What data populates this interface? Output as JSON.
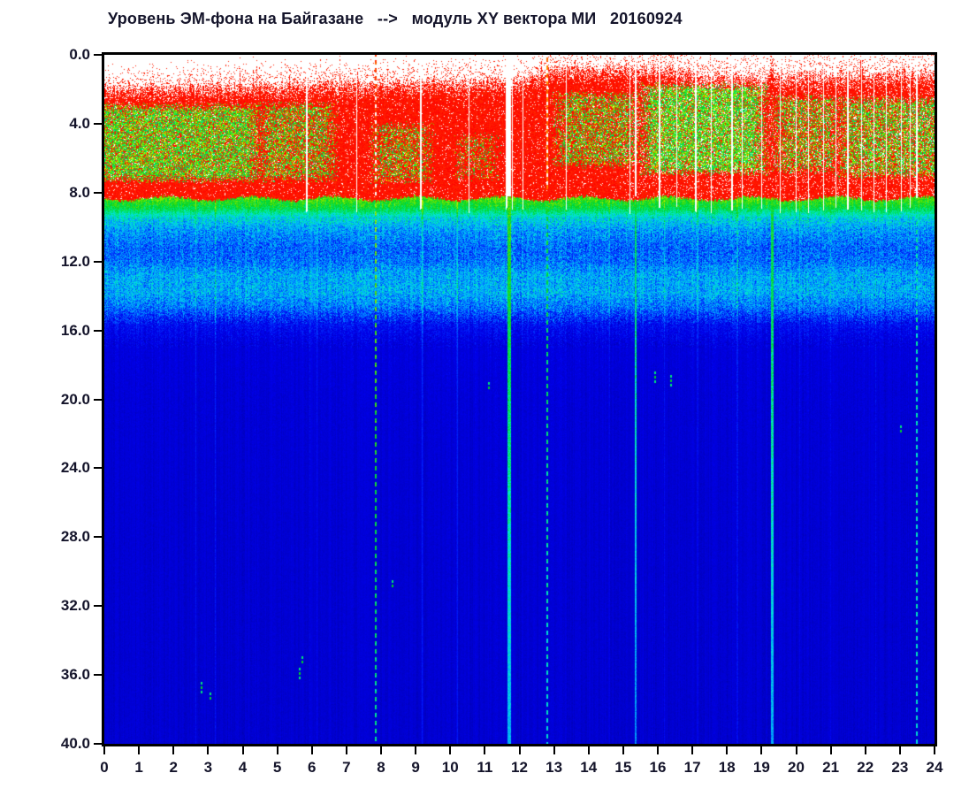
{
  "page": {
    "background": "#ffffff",
    "axis_color": "#000000",
    "text_color": "#14142a"
  },
  "chart_data": {
    "type": "heatmap",
    "title": "Уровень ЭМ-фона на Байгазане   -->   модуль XY вектора МИ   20160924",
    "x_axis": {
      "min": 0,
      "max": 24,
      "tick_labels": [
        "0",
        "1",
        "2",
        "3",
        "4",
        "5",
        "6",
        "7",
        "8",
        "9",
        "10",
        "11",
        "12",
        "13",
        "14",
        "15",
        "16",
        "17",
        "18",
        "19",
        "20",
        "21",
        "22",
        "23",
        "24"
      ]
    },
    "y_axis": {
      "min": 0,
      "max": 40,
      "inverted": true,
      "tick_labels": [
        "0.0",
        "4.0",
        "8.0",
        "12.0",
        "16.0",
        "20.0",
        "24.0",
        "28.0",
        "32.0",
        "36.0",
        "40.0"
      ]
    },
    "no_data_color": "#ffffff",
    "render": {
      "colormap_stops": [
        [
          0.0,
          0,
          0,
          150
        ],
        [
          0.08,
          0,
          0,
          200
        ],
        [
          0.16,
          0,
          0,
          235
        ],
        [
          0.24,
          0,
          60,
          255
        ],
        [
          0.32,
          0,
          160,
          255
        ],
        [
          0.4,
          0,
          225,
          225
        ],
        [
          0.46,
          0,
          230,
          120
        ],
        [
          0.52,
          0,
          210,
          40
        ],
        [
          0.58,
          110,
          230,
          0
        ],
        [
          0.65,
          220,
          240,
          0
        ],
        [
          0.72,
          255,
          220,
          0
        ],
        [
          0.8,
          255,
          120,
          0
        ],
        [
          0.86,
          255,
          40,
          0
        ],
        [
          1.0,
          255,
          0,
          0
        ]
      ],
      "band_profile": [
        [
          8.35,
          0.56
        ],
        [
          8.9,
          0.5
        ],
        [
          9.4,
          0.4
        ],
        [
          10.2,
          0.32
        ],
        [
          11.2,
          0.27
        ],
        [
          12.0,
          0.28
        ],
        [
          12.7,
          0.33
        ],
        [
          13.8,
          0.34
        ],
        [
          14.7,
          0.28
        ],
        [
          15.6,
          0.18
        ],
        [
          16.8,
          0.13
        ],
        [
          20,
          0.115
        ],
        [
          28,
          0.105
        ],
        [
          40,
          0.1
        ]
      ],
      "noise_amp": [
        [
          9.4,
          0.1
        ],
        [
          15.6,
          0.17
        ],
        [
          17,
          0.1
        ],
        [
          22,
          0.055
        ],
        [
          41,
          0.045
        ]
      ],
      "top_edge": [
        [
          0,
          1.9
        ],
        [
          5,
          1.75
        ],
        [
          8,
          1.6
        ],
        [
          11,
          1.5
        ],
        [
          12.3,
          1.3
        ],
        [
          13,
          0.8
        ],
        [
          16.3,
          0.75
        ],
        [
          17.2,
          1.15
        ],
        [
          19,
          1.25
        ],
        [
          19.6,
          1.2
        ],
        [
          21.7,
          1.1
        ],
        [
          22.1,
          1.15
        ],
        [
          23,
          1.05
        ],
        [
          24,
          1.0
        ]
      ],
      "top_spikes": [
        {
          "t": 13.6,
          "w": 0.06
        },
        {
          "t": 16.1,
          "w": 0.06
        },
        {
          "t": 19.3,
          "w": 0.1
        },
        {
          "t": 21.9,
          "w": 0.08
        }
      ],
      "hot": {
        "base": 0.86,
        "spread": 0.14,
        "bottom": 8.35,
        "dot_prob": 0.2,
        "dot_falloff": 0.14,
        "hole_base": 0.05,
        "hole_evening": 0.1,
        "evening_start": 15
      },
      "green": {
        "base": 0.44,
        "spread": 0.22
      },
      "green_patches": [
        {
          "t0": -0.2,
          "t1": 4.35,
          "f0": 3.1,
          "f1": 7.15,
          "a": 0.72
        },
        {
          "t0": 4.6,
          "t1": 6.5,
          "f0": 3.0,
          "f1": 7.1,
          "a": 0.5
        },
        {
          "t0": 7.9,
          "t1": 9.3,
          "f0": 4.2,
          "f1": 7.2,
          "a": 0.42
        },
        {
          "t0": 10.3,
          "t1": 11.2,
          "f0": 4.8,
          "f1": 7.0,
          "a": 0.25
        },
        {
          "t0": 13.2,
          "t1": 15.3,
          "f0": 2.4,
          "f1": 6.3,
          "a": 0.5
        },
        {
          "t0": 15.7,
          "t1": 18.95,
          "f0": 1.9,
          "f1": 6.7,
          "a": 0.78
        },
        {
          "t0": 19.5,
          "t1": 21.1,
          "f0": 2.6,
          "f1": 6.6,
          "a": 0.5
        },
        {
          "t0": 21.4,
          "t1": 24.2,
          "f0": 2.7,
          "f1": 6.9,
          "a": 0.58
        }
      ],
      "white_gaps": [
        {
          "t": 5.85,
          "w": 0.06
        },
        {
          "t": 7.3,
          "w": 0.04
        },
        {
          "t": 9.15,
          "w": 0.05
        },
        {
          "t": 10.55,
          "w": 0.03
        },
        {
          "t": 11.62,
          "w": 0.05
        },
        {
          "t": 11.8,
          "w": 0.04
        },
        {
          "t": 12.1,
          "w": 0.03
        },
        {
          "t": 13.35,
          "w": 0.04
        },
        {
          "t": 15.2,
          "w": 0.04
        },
        {
          "t": 16.05,
          "w": 0.05
        },
        {
          "t": 16.55,
          "w": 0.03
        },
        {
          "t": 17.1,
          "w": 0.04
        },
        {
          "t": 17.55,
          "w": 0.03
        },
        {
          "t": 18.15,
          "w": 0.04
        },
        {
          "t": 18.45,
          "w": 0.03
        },
        {
          "t": 19.0,
          "w": 0.04
        },
        {
          "t": 19.55,
          "w": 0.03
        },
        {
          "t": 20.0,
          "w": 0.05
        },
        {
          "t": 20.35,
          "w": 0.03
        },
        {
          "t": 20.8,
          "w": 0.03
        },
        {
          "t": 21.15,
          "w": 0.04
        },
        {
          "t": 21.5,
          "w": 0.04
        },
        {
          "t": 21.9,
          "w": 0.03
        },
        {
          "t": 22.25,
          "w": 0.04
        },
        {
          "t": 22.6,
          "w": 0.03
        },
        {
          "t": 23.05,
          "w": 0.03
        },
        {
          "t": 23.3,
          "w": 0.03
        }
      ],
      "bright_lines": [
        {
          "t": 11.71,
          "w": 0.09,
          "v_top": 0.55,
          "v_bottom": 0.34,
          "f_start": 8.2,
          "gap_hot": true
        },
        {
          "t": 15.35,
          "w": 0.05,
          "v_top": 0.5,
          "v_bottom": 0.3,
          "f_start": 8.2,
          "gap_hot": true
        },
        {
          "t": 19.31,
          "w": 0.06,
          "v_top": 0.52,
          "v_bottom": 0.33,
          "f_start": 8.2,
          "gap_hot": false
        }
      ],
      "dashed_lines": [
        {
          "t": 7.85,
          "w": 0.055,
          "f_green_start": 8.3,
          "gap_hot": true,
          "hot_dash_v": 0.85,
          "v_upper": 0.6,
          "v_lower": 0.44,
          "off": 3
        },
        {
          "t": 12.81,
          "w": 0.05,
          "f_green_start": 7.8,
          "gap_hot": true,
          "hot_dash_v": 0.8,
          "v_upper": 0.52,
          "v_lower": 0.4,
          "off": 6
        },
        {
          "t": 23.49,
          "w": 0.05,
          "f_green_start": 8.3,
          "gap_hot": true,
          "hot_dash_v": null,
          "v_upper": 0.44,
          "v_lower": 0.4,
          "off": 0
        }
      ],
      "faint_lines": [
        2.65,
        3.2,
        5.95,
        6.15,
        9.2,
        10.2,
        14.6,
        16.2,
        17.15,
        18.3,
        20.1,
        21.0,
        22.3
      ],
      "specks": [
        {
          "t": 2.78,
          "f": 36.4,
          "n": 3
        },
        {
          "t": 3.05,
          "f": 37.0,
          "n": 2
        },
        {
          "t": 5.62,
          "f": 35.6,
          "n": 3
        },
        {
          "t": 5.7,
          "f": 34.9,
          "n": 2
        },
        {
          "t": 15.9,
          "f": 18.4,
          "n": 3
        },
        {
          "t": 16.35,
          "f": 18.6,
          "n": 3
        },
        {
          "t": 11.1,
          "f": 19.0,
          "n": 2
        },
        {
          "t": 8.3,
          "f": 30.5,
          "n": 2
        },
        {
          "t": 23.0,
          "f": 21.5,
          "n": 2
        }
      ]
    }
  }
}
